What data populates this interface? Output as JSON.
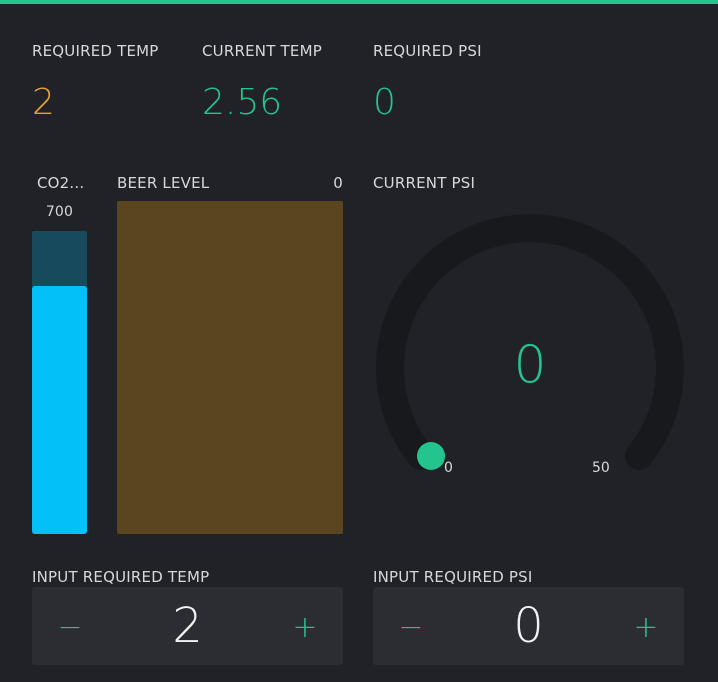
{
  "colors": {
    "accent_green": "#23c48e",
    "accent_orange": "#e8a23a",
    "co2_fill": "#04c0f8",
    "co2_track": "#184a5e",
    "beer_fill": "#5a4520",
    "gauge_track": "#18191d"
  },
  "required_temp": {
    "label": "REQUIRED TEMP",
    "value": "2"
  },
  "current_temp": {
    "label": "CURRENT TEMP",
    "value": "2.56"
  },
  "required_psi": {
    "label": "REQUIRED PSI",
    "value": "0"
  },
  "co2": {
    "label": "CO2...",
    "value": "700",
    "fill_fraction": 0.82
  },
  "beer_level": {
    "label": "BEER LEVEL",
    "value": "0",
    "fill_fraction": 1.0
  },
  "current_psi": {
    "label": "CURRENT PSI",
    "value": "0",
    "min": "0",
    "max": "50",
    "level_fraction": 0
  },
  "input_required_temp": {
    "label": "INPUT REQUIRED TEMP",
    "value": "2",
    "minus_label": "−",
    "plus_label": "+"
  },
  "input_required_psi": {
    "label": "INPUT REQUIRED PSI",
    "value": "0",
    "minus_label": "−",
    "plus_label": "+"
  }
}
